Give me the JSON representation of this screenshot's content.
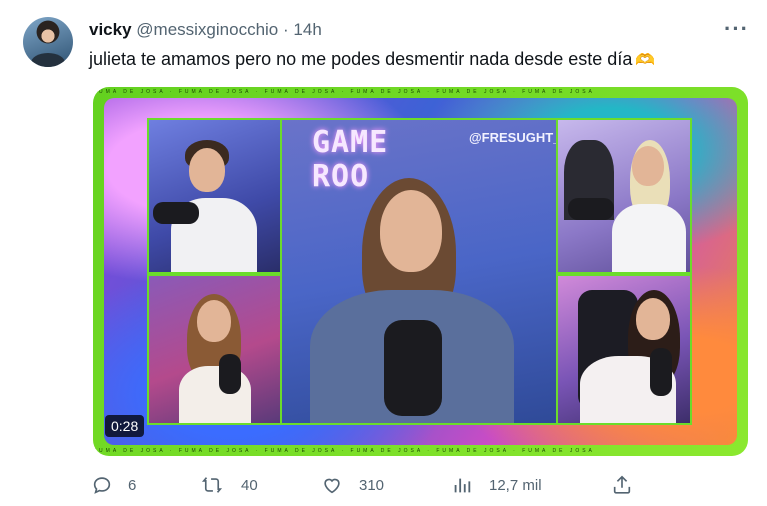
{
  "tweet": {
    "display_name": "vicky",
    "handle": "@messixginocchio",
    "separator": "·",
    "time": "14h",
    "more_label": "···",
    "text": "julieta te amamos pero no me podes desmentir nada desde este día",
    "text_emoji": "🫶",
    "media": {
      "stage_sign": "GAME\nROO",
      "watermark": "@FRESUGHT_",
      "duration": "0:28",
      "ticker_text": "FUMA DE JOSA  ·  FUMA DE JOSA  ·  FUMA DE JOSA  ·  FUMA DE JOSA  ·  FUMA DE JOSA  ·  FUMA DE JOSA"
    },
    "actions": {
      "reply_count": "6",
      "retweet_count": "40",
      "like_count": "310",
      "views_count": "12,7 mil"
    }
  },
  "colors": {
    "text_primary": "#0f1419",
    "text_secondary": "#536471",
    "media_frame": "#6bdc2b"
  },
  "icons": [
    "reply-icon",
    "retweet-icon",
    "like-icon",
    "views-icon",
    "share-icon",
    "more-icon"
  ]
}
